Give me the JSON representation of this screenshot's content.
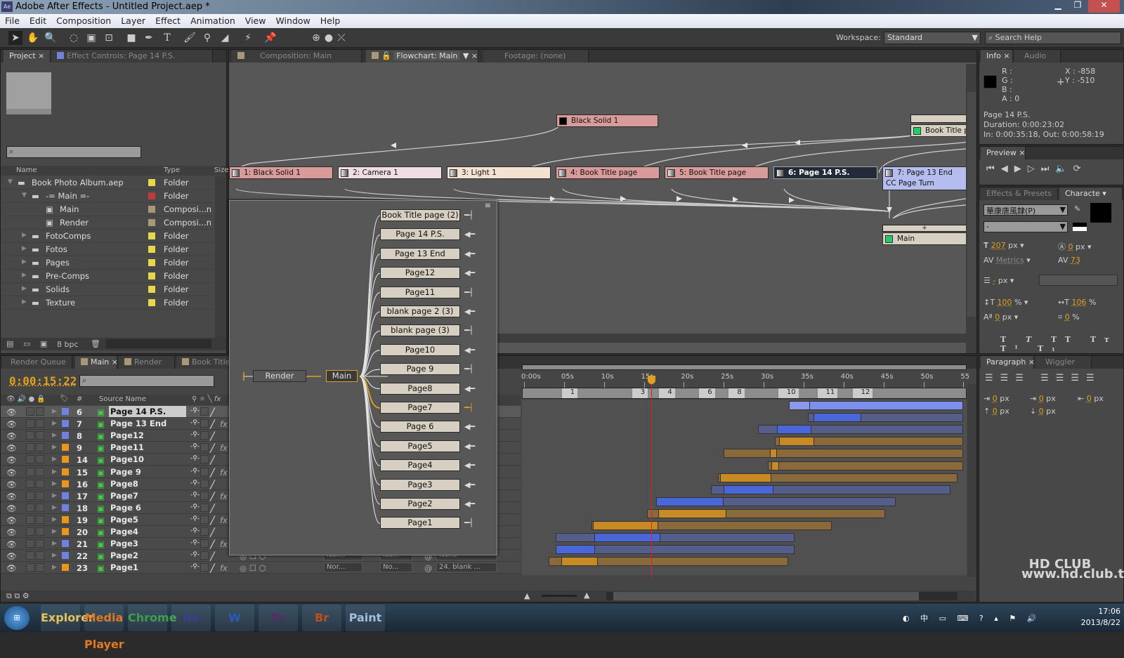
{
  "window": {
    "app_icon": "Ae",
    "title": "Adobe After Effects - Untitled Project.aep *"
  },
  "menu": [
    "File",
    "Edit",
    "Composition",
    "Layer",
    "Effect",
    "Animation",
    "View",
    "Window",
    "Help"
  ],
  "toolbar": {
    "workspace_label": "Workspace:",
    "workspace_value": "Standard",
    "search_placeholder": "Search Help"
  },
  "project": {
    "tab": "Project",
    "effect_controls_tab": "Effect Controls: Page 14 P.S.",
    "columns": {
      "name": "Name",
      "type": "Type",
      "size": "Size"
    },
    "items": [
      {
        "name": "Book Photo Album.aep",
        "type": "Folder",
        "color": "#e6d84a",
        "indent": 0,
        "kind": "folder",
        "expand": "open"
      },
      {
        "name": "-= Main =-",
        "type": "Folder",
        "color": "#c03a3a",
        "indent": 1,
        "kind": "folder",
        "expand": "open"
      },
      {
        "name": "Main",
        "type": "Composi...n",
        "color": "#a89878",
        "indent": 2,
        "kind": "comp",
        "expand": ""
      },
      {
        "name": "Render",
        "type": "Composi...n",
        "color": "#a89878",
        "indent": 2,
        "kind": "comp",
        "expand": ""
      },
      {
        "name": "FotoComps",
        "type": "Folder",
        "color": "#e6d84a",
        "indent": 1,
        "kind": "folder",
        "expand": "closed"
      },
      {
        "name": "Fotos",
        "type": "Folder",
        "color": "#e6d84a",
        "indent": 1,
        "kind": "folder",
        "expand": "closed"
      },
      {
        "name": "Pages",
        "type": "Folder",
        "color": "#e6d84a",
        "indent": 1,
        "kind": "folder",
        "expand": "closed"
      },
      {
        "name": "Pre-Comps",
        "type": "Folder",
        "color": "#e6d84a",
        "indent": 1,
        "kind": "folder",
        "expand": "closed"
      },
      {
        "name": "Solids",
        "type": "Folder",
        "color": "#e6d84a",
        "indent": 1,
        "kind": "folder",
        "expand": "closed"
      },
      {
        "name": "Texture",
        "type": "Folder",
        "color": "#e6d84a",
        "indent": 1,
        "kind": "folder",
        "expand": "closed"
      }
    ],
    "bpc": "8 bpc"
  },
  "viewer": {
    "tabs": [
      "Composition: Main",
      "Flowchart: Main",
      "Footage: (none)"
    ],
    "top_node": "Black Solid 1",
    "book_title_node": "Book Title pa",
    "layer_nodes": [
      {
        "label": "1: Black Solid 1",
        "color": "#d99a9a",
        "icon": "solid"
      },
      {
        "label": "2: Camera 1",
        "color": "#f0dde2",
        "icon": "camera"
      },
      {
        "label": "3: Light 1",
        "color": "#f3e2d2",
        "icon": "light"
      },
      {
        "label": "4: Book Title page",
        "color": "#d99a9a",
        "icon": "solid"
      },
      {
        "label": "5: Book Title page",
        "color": "#d99a9a",
        "icon": "solid"
      },
      {
        "label": "6: Page 14 P.S.",
        "color": "#252a38",
        "icon": "solid"
      },
      {
        "label": "7: Page 13  End",
        "color": "#b4bdee",
        "icon": "solid",
        "effect": "CC Page Turn"
      }
    ],
    "main_node": "Main"
  },
  "flowchart_popup": {
    "left_nodes": [
      "Render",
      "Main"
    ],
    "nodes": [
      {
        "label": "Book Title page (2)",
        "conn": "bar"
      },
      {
        "label": "Page 14 P.S.",
        "conn": "arrow"
      },
      {
        "label": "Page 13  End",
        "conn": "arrow"
      },
      {
        "label": "Page12",
        "conn": "arrow"
      },
      {
        "label": "Page11",
        "conn": "bar"
      },
      {
        "label": "blank page 2 (3)",
        "conn": "arrow"
      },
      {
        "label": "blank page (3)",
        "conn": "bar"
      },
      {
        "label": "Page10",
        "conn": "arrow"
      },
      {
        "label": "Page 9",
        "conn": "bar"
      },
      {
        "label": "Page8",
        "conn": "arrow"
      },
      {
        "label": "Page7",
        "conn": "bar-active"
      },
      {
        "label": "Page 6",
        "conn": "arrow"
      },
      {
        "label": "Page5",
        "conn": "arrow"
      },
      {
        "label": "Page4",
        "conn": "arrow"
      },
      {
        "label": "Page3",
        "conn": "arrow"
      },
      {
        "label": "Page2",
        "conn": "arrow"
      },
      {
        "label": "Page1",
        "conn": "bar"
      }
    ]
  },
  "timeline": {
    "tabs": [
      "Render Queue",
      "Main",
      "Render",
      "Book Title"
    ],
    "timecode": "0:00:15:22",
    "current_time_s": 15.9,
    "columns": {
      "num": "#",
      "source": "Source Name"
    },
    "ruler": [
      "0:00s",
      "05s",
      "10s",
      "15s",
      "20s",
      "25s",
      "30s",
      "35s",
      "40s",
      "45s",
      "50s",
      "55"
    ],
    "markers": [
      {
        "label": "1",
        "t": 4.9
      },
      {
        "label": "3",
        "t": 13.7
      },
      {
        "label": "4",
        "t": 17.1
      },
      {
        "label": "6",
        "t": 22.1
      },
      {
        "label": "8",
        "t": 25.8
      },
      {
        "label": "10",
        "t": 32.0
      },
      {
        "label": "11",
        "t": 36.9
      },
      {
        "label": "12",
        "t": 41.3
      }
    ],
    "layers": [
      {
        "num": "6",
        "name": "Page 14 P.S.",
        "color": "#6f82e0",
        "fx": false,
        "selected": true,
        "start": 33.2,
        "end": 55.0,
        "in": 35.7,
        "out": 55.0
      },
      {
        "num": "7",
        "name": "Page 13  End",
        "color": "#6f82e0",
        "fx": true,
        "start": 35.5,
        "end": 55.0,
        "in": 36.2,
        "out": 42.2
      },
      {
        "num": "8",
        "name": "Page12",
        "color": "#6f82e0",
        "fx": false,
        "start": 29.3,
        "end": 55.0,
        "in": 31.7,
        "out": 36.0
      },
      {
        "num": "9",
        "name": "Page11",
        "color": "#e8961c",
        "fx": true,
        "start": 31.4,
        "end": 55.0,
        "in": 31.9,
        "out": 36.3
      },
      {
        "num": "14",
        "name": "Page10",
        "color": "#e8961c",
        "fx": false,
        "start": 25.0,
        "end": 55.0,
        "in": 30.8,
        "out": 31.7
      },
      {
        "num": "15",
        "name": "Page 9",
        "color": "#e8961c",
        "fx": true,
        "start": 30.5,
        "end": 55.0,
        "in": 31.0,
        "out": 31.9
      },
      {
        "num": "16",
        "name": "Page8",
        "color": "#e8961c",
        "fx": false,
        "start": 24.3,
        "end": 54.3,
        "in": 24.5,
        "out": 31.0
      },
      {
        "num": "17",
        "name": "Page7",
        "color": "#6f82e0",
        "fx": true,
        "start": 23.4,
        "end": 53.4,
        "in": 25.0,
        "out": 31.2
      },
      {
        "num": "18",
        "name": "Page 6",
        "color": "#6f82e0",
        "fx": false,
        "start": 16.5,
        "end": 46.5,
        "in": 16.5,
        "out": 25.0
      },
      {
        "num": "19",
        "name": "Page5",
        "color": "#e8961c",
        "fx": true,
        "start": 15.4,
        "end": 45.2,
        "in": 16.8,
        "out": 25.3
      },
      {
        "num": "20",
        "name": "Page4",
        "color": "#e8961c",
        "fx": false,
        "start": 8.4,
        "end": 38.5,
        "in": 8.6,
        "out": 16.8
      },
      {
        "num": "21",
        "name": "Page3",
        "color": "#6f82e0",
        "fx": true,
        "start": 4.0,
        "end": 33.9,
        "in": 8.8,
        "out": 17.1
      },
      {
        "num": "22",
        "name": "Page2",
        "color": "#6f82e0",
        "fx": false,
        "start": 4.0,
        "end": 33.9,
        "in": 4.0,
        "out": 8.9,
        "mode": "Nor...",
        "trkmat": "No...",
        "parent": "None"
      },
      {
        "num": "23",
        "name": "Page1",
        "color": "#e8961c",
        "fx": true,
        "start": 3.1,
        "end": 33.1,
        "in": 4.7,
        "out": 9.2,
        "mode": "Nor...",
        "trkmat": "No...",
        "parent": "24. blank ..."
      }
    ]
  },
  "info": {
    "tab": "Info",
    "audio_tab": "Audio",
    "r": "R :",
    "g": "G :",
    "b": "B :",
    "a": "A :  0",
    "x": "X : -858",
    "y": "Y : -510",
    "layer": "Page 14 P.S.",
    "duration": "Duration: 0:00:23:02",
    "inout": "In: 0:00:35:18, Out: 0:00:58:19"
  },
  "preview": {
    "tab": "Preview"
  },
  "character": {
    "effects_tab": "Effects & Presets",
    "tab": "Characte",
    "font": "華康唐風隸(P)",
    "style": "-",
    "size": "207",
    "size_unit": "px",
    "leading": "0",
    "leading_unit": "px",
    "kerning": "Metrics",
    "tracking": "73",
    "stroke": "-",
    "stroke_unit": "px",
    "vscale": "100",
    "hscale": "106",
    "baseline": "0",
    "baseline_unit": "px",
    "tsume": "0",
    "pct": "%"
  },
  "paragraph": {
    "tab": "Paragraph",
    "wiggler_tab": "Wiggler",
    "values": [
      "0",
      "0",
      "0",
      "0",
      "0"
    ],
    "unit": "px"
  },
  "watermark": "HD CLUB www.hd.club.tw",
  "taskbar": {
    "apps": [
      "Explorer",
      "Media Player",
      "Chrome",
      "Ae",
      "W",
      "Pr",
      "Br",
      "Paint"
    ],
    "ime": "中",
    "time": "17:06",
    "date": "2013/8/22"
  }
}
